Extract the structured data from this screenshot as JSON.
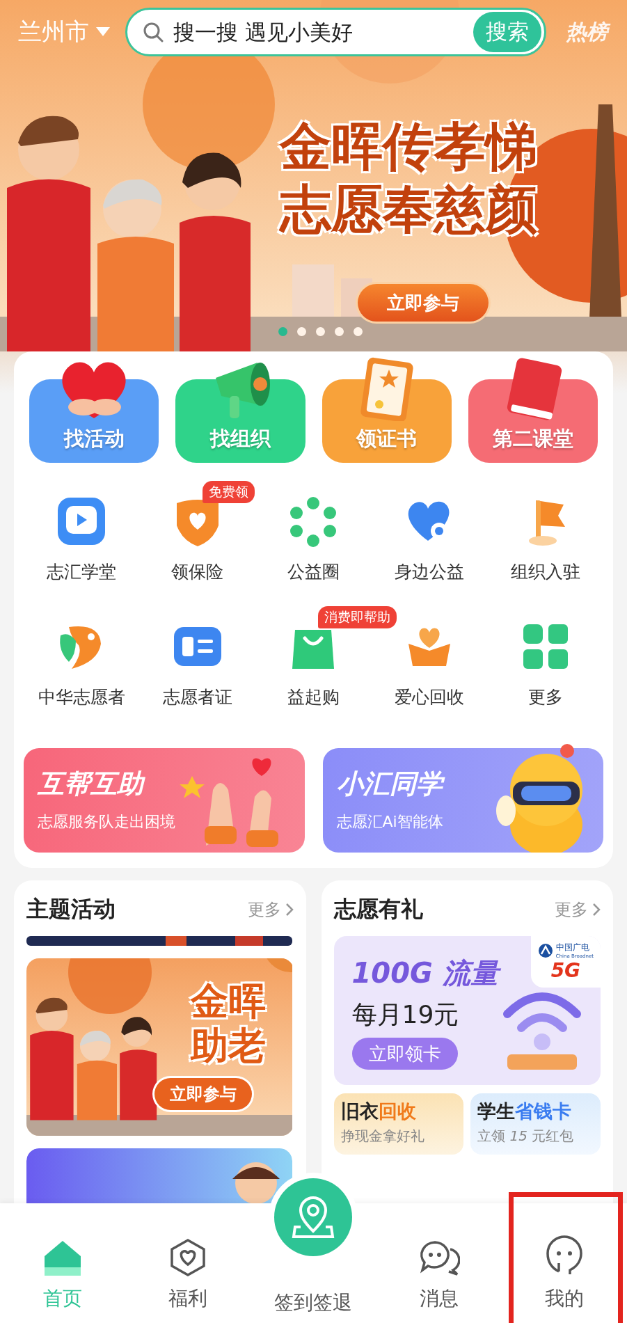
{
  "top_bar": {
    "city": "兰州市",
    "search": {
      "placeholder": "搜一搜 遇见小美好",
      "button": "搜索"
    },
    "hot_list": "热榜"
  },
  "banner": {
    "title_lines": [
      "金晖传孝悌",
      "志愿奉慈颜"
    ],
    "button": "立即参与",
    "dots": [
      {
        "selected": true
      },
      {
        "selected": false
      },
      {
        "selected": false
      },
      {
        "selected": false
      },
      {
        "selected": false
      }
    ]
  },
  "feature_tiles": [
    {
      "label": "找活动",
      "color": "#5a9ef6"
    },
    {
      "label": "找组织",
      "color": "#2fd38a"
    },
    {
      "label": "领证书",
      "color": "#f8a23a"
    },
    {
      "label": "第二课堂",
      "color": "#f56c74"
    }
  ],
  "shortcuts": [
    {
      "label": "志汇学堂"
    },
    {
      "label": "领保险",
      "badge": "免费领"
    },
    {
      "label": "公益圈"
    },
    {
      "label": "身边公益"
    },
    {
      "label": "组织入驻"
    },
    {
      "label": "中华志愿者"
    },
    {
      "label": "志愿者证"
    },
    {
      "label": "益起购",
      "badge": "消费即帮助"
    },
    {
      "label": "爱心回收"
    },
    {
      "label": "更多"
    }
  ],
  "promos": [
    {
      "title": "互帮互助",
      "subtitle": "志愿服务队走出困境",
      "color": "#f7667a"
    },
    {
      "title": "小汇同学",
      "subtitle": "志愿汇Ai智能体",
      "color": "#8b8df8"
    }
  ],
  "theme_activities": {
    "title": "主题活动",
    "more": "更多",
    "card": {
      "title_lines": [
        "金晖",
        "助老"
      ],
      "button": "立即参与"
    }
  },
  "volunteer_gifts": {
    "title": "志愿有礼",
    "more": "更多",
    "offer": {
      "title": "100G 流量",
      "price": "每月19元",
      "button": "立即领卡",
      "brand": "中国广电",
      "brand_en": "China Broadnet",
      "network": "5G"
    },
    "mini_cards": [
      {
        "title": "旧衣",
        "accent": "回收",
        "subtitle": "挣现金拿好礼",
        "color": "#f07a1a"
      },
      {
        "title": "学生",
        "accent": "省钱卡",
        "subtitle": "立领 *15* 元红包",
        "color": "#3a7cf0"
      }
    ]
  },
  "nav": {
    "tabs": [
      {
        "label": "首页",
        "kind": "tab",
        "selected": true,
        "highlighted": false
      },
      {
        "label": "福利",
        "kind": "tab",
        "selected": false,
        "highlighted": false
      },
      {
        "label": "签到签退",
        "kind": "center",
        "selected": false,
        "highlighted": false
      },
      {
        "label": "消息",
        "kind": "tab",
        "selected": false,
        "highlighted": false
      },
      {
        "label": "我的",
        "kind": "tab",
        "selected": false,
        "highlighted": true
      }
    ]
  }
}
